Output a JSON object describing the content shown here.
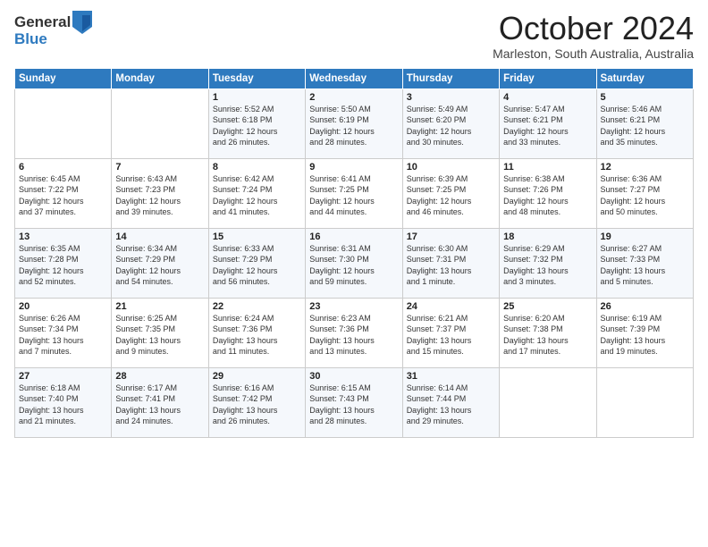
{
  "logo": {
    "general": "General",
    "blue": "Blue"
  },
  "header": {
    "month": "October 2024",
    "location": "Marleston, South Australia, Australia"
  },
  "weekdays": [
    "Sunday",
    "Monday",
    "Tuesday",
    "Wednesday",
    "Thursday",
    "Friday",
    "Saturday"
  ],
  "weeks": [
    [
      {
        "day": "",
        "sunrise": "",
        "sunset": "",
        "daylight": ""
      },
      {
        "day": "",
        "sunrise": "",
        "sunset": "",
        "daylight": ""
      },
      {
        "day": "1",
        "sunrise": "Sunrise: 5:52 AM",
        "sunset": "Sunset: 6:18 PM",
        "daylight": "Daylight: 12 hours and 26 minutes."
      },
      {
        "day": "2",
        "sunrise": "Sunrise: 5:50 AM",
        "sunset": "Sunset: 6:19 PM",
        "daylight": "Daylight: 12 hours and 28 minutes."
      },
      {
        "day": "3",
        "sunrise": "Sunrise: 5:49 AM",
        "sunset": "Sunset: 6:20 PM",
        "daylight": "Daylight: 12 hours and 30 minutes."
      },
      {
        "day": "4",
        "sunrise": "Sunrise: 5:47 AM",
        "sunset": "Sunset: 6:21 PM",
        "daylight": "Daylight: 12 hours and 33 minutes."
      },
      {
        "day": "5",
        "sunrise": "Sunrise: 5:46 AM",
        "sunset": "Sunset: 6:21 PM",
        "daylight": "Daylight: 12 hours and 35 minutes."
      }
    ],
    [
      {
        "day": "6",
        "sunrise": "Sunrise: 6:45 AM",
        "sunset": "Sunset: 7:22 PM",
        "daylight": "Daylight: 12 hours and 37 minutes."
      },
      {
        "day": "7",
        "sunrise": "Sunrise: 6:43 AM",
        "sunset": "Sunset: 7:23 PM",
        "daylight": "Daylight: 12 hours and 39 minutes."
      },
      {
        "day": "8",
        "sunrise": "Sunrise: 6:42 AM",
        "sunset": "Sunset: 7:24 PM",
        "daylight": "Daylight: 12 hours and 41 minutes."
      },
      {
        "day": "9",
        "sunrise": "Sunrise: 6:41 AM",
        "sunset": "Sunset: 7:25 PM",
        "daylight": "Daylight: 12 hours and 44 minutes."
      },
      {
        "day": "10",
        "sunrise": "Sunrise: 6:39 AM",
        "sunset": "Sunset: 7:25 PM",
        "daylight": "Daylight: 12 hours and 46 minutes."
      },
      {
        "day": "11",
        "sunrise": "Sunrise: 6:38 AM",
        "sunset": "Sunset: 7:26 PM",
        "daylight": "Daylight: 12 hours and 48 minutes."
      },
      {
        "day": "12",
        "sunrise": "Sunrise: 6:36 AM",
        "sunset": "Sunset: 7:27 PM",
        "daylight": "Daylight: 12 hours and 50 minutes."
      }
    ],
    [
      {
        "day": "13",
        "sunrise": "Sunrise: 6:35 AM",
        "sunset": "Sunset: 7:28 PM",
        "daylight": "Daylight: 12 hours and 52 minutes."
      },
      {
        "day": "14",
        "sunrise": "Sunrise: 6:34 AM",
        "sunset": "Sunset: 7:29 PM",
        "daylight": "Daylight: 12 hours and 54 minutes."
      },
      {
        "day": "15",
        "sunrise": "Sunrise: 6:33 AM",
        "sunset": "Sunset: 7:29 PM",
        "daylight": "Daylight: 12 hours and 56 minutes."
      },
      {
        "day": "16",
        "sunrise": "Sunrise: 6:31 AM",
        "sunset": "Sunset: 7:30 PM",
        "daylight": "Daylight: 12 hours and 59 minutes."
      },
      {
        "day": "17",
        "sunrise": "Sunrise: 6:30 AM",
        "sunset": "Sunset: 7:31 PM",
        "daylight": "Daylight: 13 hours and 1 minute."
      },
      {
        "day": "18",
        "sunrise": "Sunrise: 6:29 AM",
        "sunset": "Sunset: 7:32 PM",
        "daylight": "Daylight: 13 hours and 3 minutes."
      },
      {
        "day": "19",
        "sunrise": "Sunrise: 6:27 AM",
        "sunset": "Sunset: 7:33 PM",
        "daylight": "Daylight: 13 hours and 5 minutes."
      }
    ],
    [
      {
        "day": "20",
        "sunrise": "Sunrise: 6:26 AM",
        "sunset": "Sunset: 7:34 PM",
        "daylight": "Daylight: 13 hours and 7 minutes."
      },
      {
        "day": "21",
        "sunrise": "Sunrise: 6:25 AM",
        "sunset": "Sunset: 7:35 PM",
        "daylight": "Daylight: 13 hours and 9 minutes."
      },
      {
        "day": "22",
        "sunrise": "Sunrise: 6:24 AM",
        "sunset": "Sunset: 7:36 PM",
        "daylight": "Daylight: 13 hours and 11 minutes."
      },
      {
        "day": "23",
        "sunrise": "Sunrise: 6:23 AM",
        "sunset": "Sunset: 7:36 PM",
        "daylight": "Daylight: 13 hours and 13 minutes."
      },
      {
        "day": "24",
        "sunrise": "Sunrise: 6:21 AM",
        "sunset": "Sunset: 7:37 PM",
        "daylight": "Daylight: 13 hours and 15 minutes."
      },
      {
        "day": "25",
        "sunrise": "Sunrise: 6:20 AM",
        "sunset": "Sunset: 7:38 PM",
        "daylight": "Daylight: 13 hours and 17 minutes."
      },
      {
        "day": "26",
        "sunrise": "Sunrise: 6:19 AM",
        "sunset": "Sunset: 7:39 PM",
        "daylight": "Daylight: 13 hours and 19 minutes."
      }
    ],
    [
      {
        "day": "27",
        "sunrise": "Sunrise: 6:18 AM",
        "sunset": "Sunset: 7:40 PM",
        "daylight": "Daylight: 13 hours and 21 minutes."
      },
      {
        "day": "28",
        "sunrise": "Sunrise: 6:17 AM",
        "sunset": "Sunset: 7:41 PM",
        "daylight": "Daylight: 13 hours and 24 minutes."
      },
      {
        "day": "29",
        "sunrise": "Sunrise: 6:16 AM",
        "sunset": "Sunset: 7:42 PM",
        "daylight": "Daylight: 13 hours and 26 minutes."
      },
      {
        "day": "30",
        "sunrise": "Sunrise: 6:15 AM",
        "sunset": "Sunset: 7:43 PM",
        "daylight": "Daylight: 13 hours and 28 minutes."
      },
      {
        "day": "31",
        "sunrise": "Sunrise: 6:14 AM",
        "sunset": "Sunset: 7:44 PM",
        "daylight": "Daylight: 13 hours and 29 minutes."
      },
      {
        "day": "",
        "sunrise": "",
        "sunset": "",
        "daylight": ""
      },
      {
        "day": "",
        "sunrise": "",
        "sunset": "",
        "daylight": ""
      }
    ]
  ]
}
